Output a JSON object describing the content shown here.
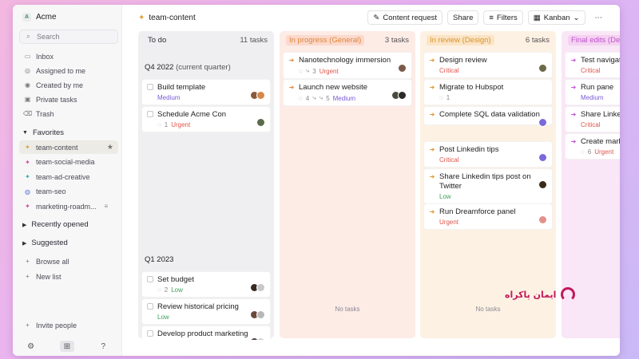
{
  "sidebar": {
    "workspace": "Acme",
    "workspace_logo": "A",
    "search_placeholder": "Search",
    "nav": [
      {
        "label": "Inbox",
        "icon": "inbox-icon"
      },
      {
        "label": "Assigned to me",
        "icon": "at-icon"
      },
      {
        "label": "Created by me",
        "icon": "user-icon"
      },
      {
        "label": "Private tasks",
        "icon": "lock-icon"
      },
      {
        "label": "Trash",
        "icon": "trash-icon"
      }
    ],
    "favorites_title": "Favorites",
    "favorites": [
      {
        "label": "team-content",
        "icon": "sparkle-icon",
        "color": "#e3a12f"
      },
      {
        "label": "team-social-media",
        "icon": "sparkle-icon",
        "color": "#d447b0"
      },
      {
        "label": "team-ad-creative",
        "icon": "sparkle-icon",
        "color": "#3aa7b8"
      },
      {
        "label": "team-seo",
        "icon": "globe-icon",
        "color": "#5a78d9"
      },
      {
        "label": "marketing-roadm...",
        "icon": "sparkle-icon",
        "color": "#d447b0"
      }
    ],
    "recently_opened": "Recently opened",
    "suggested": "Suggested",
    "browse_all": "Browse all",
    "new_list": "New list",
    "invite_people": "Invite people"
  },
  "topbar": {
    "breadcrumb": "team-content",
    "content_request": "Content request",
    "share": "Share",
    "filters": "Filters",
    "view": "Kanban"
  },
  "columns": [
    {
      "title": "To do",
      "count": "11 tasks",
      "accent": "#2a2a33",
      "bg": "#efeff1",
      "title_bg": "transparent",
      "mark": "box",
      "groups": [
        {
          "title": "Q4 2022",
          "subtitle": "(current quarter)",
          "cards": [
            {
              "title": "Build template",
              "meta": [],
              "priority": "Medium",
              "avatars": [
                "#8a5a3c",
                "#d6884a"
              ]
            },
            {
              "title": "Schedule Acme Con",
              "meta": [
                "1"
              ],
              "priority": "Urgent",
              "avatars": [
                "#5a6a4a"
              ]
            }
          ]
        },
        {
          "title": "Q1 2023",
          "subtitle": "",
          "cards": [
            {
              "title": "Set budget",
              "meta": [
                "2"
              ],
              "priority": "Low",
              "avatars": [
                "#3a2a22",
                "#c8c8c8"
              ]
            },
            {
              "title": "Review historical pricing",
              "meta": [],
              "priority": "Low",
              "avatars": [
                "#6a4a3a",
                "#b8b8b8"
              ]
            },
            {
              "title": "Develop product marketing",
              "meta": [],
              "priority": "",
              "avatars": [
                "#4a3a3a",
                "#d0d0d0"
              ]
            }
          ]
        }
      ]
    },
    {
      "title": "In progress (General)",
      "count": "3 tasks",
      "accent": "#e0853a",
      "bg": "#fdebe6",
      "title_bg": "#fbd9cc",
      "mark": "arrow",
      "groups": [
        {
          "title": "",
          "subtitle": "",
          "cards": [
            {
              "title": "Nanotechnology immersion",
              "meta": [
                "",
                "3"
              ],
              "priority": "Urgent",
              "avatars": [
                "#7a5a4a"
              ]
            },
            {
              "title": "Launch new website",
              "meta": [
                "4",
                "",
                "5"
              ],
              "priority": "Medium",
              "avatars": [
                "#4a4a3a",
                "#2a2a2a"
              ]
            }
          ]
        },
        {
          "title": "",
          "subtitle": "",
          "empty": "No tasks",
          "cards": []
        }
      ]
    },
    {
      "title": "In review (Design)",
      "count": "6 tasks",
      "accent": "#d9942a",
      "bg": "#fdf1e3",
      "title_bg": "#fbe4c6",
      "mark": "arrow",
      "groups": [
        {
          "title": "",
          "subtitle": "",
          "cards": [
            {
              "title": "Design review",
              "meta": [],
              "priority": "Critical",
              "avatars": [
                "#6a6a4a"
              ]
            },
            {
              "title": "Migrate to Hubspot",
              "meta": [
                "1"
              ],
              "priority": "",
              "avatars": []
            },
            {
              "title": "Complete SQL data validation",
              "meta": [],
              "priority": "",
              "avatars": [
                "#7a6ad9"
              ]
            },
            {
              "title": "Post Linkedin tips",
              "meta": [],
              "priority": "Critical",
              "avatars": [
                "#7a6ad9"
              ]
            },
            {
              "title": "Share Linkedin tips post on Twitter",
              "meta": [],
              "priority": "Low",
              "avatars": [
                "#3a2a1a"
              ]
            },
            {
              "title": "Run Dreamforce panel",
              "meta": [],
              "priority": "Urgent",
              "avatars": [
                "#e3908a"
              ]
            }
          ]
        },
        {
          "title": "",
          "subtitle": "",
          "empty": "No tasks",
          "cards": []
        }
      ]
    },
    {
      "title": "Final edits (Des",
      "count": "",
      "accent": "#c04fd0",
      "bg": "#f9e6f6",
      "title_bg": "#f4d2f0",
      "mark": "arrow",
      "groups": [
        {
          "title": "",
          "subtitle": "",
          "cards": [
            {
              "title": "Test navigati",
              "meta": [],
              "priority": "Critical",
              "avatars": []
            },
            {
              "title": "Run pane",
              "meta": [],
              "priority": "Medium",
              "avatars": []
            },
            {
              "title": "Share Linked",
              "meta": [],
              "priority": "Critical",
              "avatars": []
            },
            {
              "title": "Create marke capacity plar",
              "meta": [
                "6"
              ],
              "priority": "Urgent",
              "avatars": []
            }
          ]
        },
        {
          "title": "",
          "subtitle": "",
          "empty": "N",
          "cards": []
        }
      ]
    }
  ],
  "watermark": "ایمان پاکراه"
}
